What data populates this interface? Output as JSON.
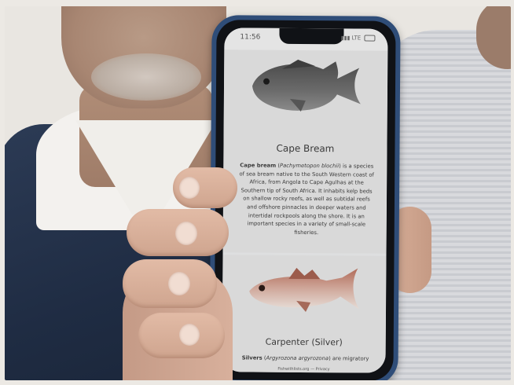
{
  "phone": {
    "status_time": "11:56",
    "status_network": "LTE",
    "screen_background": "#dedfe0"
  },
  "fish_entries": [
    {
      "icon": "cape-bream-fish-illustration",
      "title": "Cape Bream",
      "description_common_name": "Cape bream",
      "description_scientific_name": "Pachymetopon blochii",
      "description_rest": "is a species of sea bream native to the South Western coast of Africa, from Angola to Cape Agulhas at the Southern tip of South Africa. It inhabits kelp beds on shallow rocky reefs, as well as subtidal reefs and offshore pinnacles in deeper waters and intertidal rockpools along the shore. It is an important species in a variety of small-scale fisheries."
    },
    {
      "icon": "carpenter-silver-fish-illustration",
      "title": "Carpenter (Silver)",
      "description_common_name": "Silvers",
      "description_scientific_name": "Argyrozona argyrozona",
      "description_rest": "are migratory"
    }
  ],
  "footer": {
    "link_text": "Fishwithlists.org",
    "separator": "—",
    "privacy": "Privacy"
  },
  "colors": {
    "phone_frame": "#2f4d78",
    "shirt_left": "#1f2c43"
  }
}
